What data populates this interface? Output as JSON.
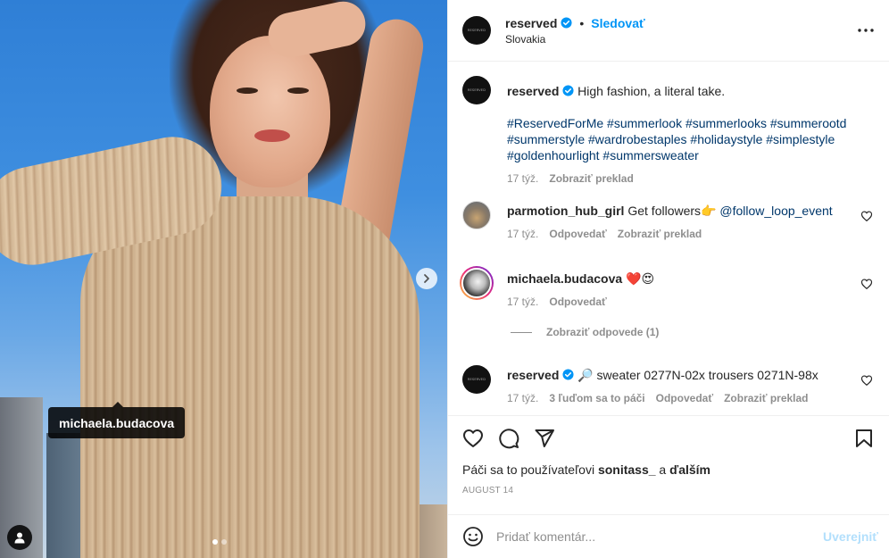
{
  "media": {
    "tag_username": "michaela.budacova",
    "carousel_count": 2,
    "carousel_active": 0
  },
  "header": {
    "avatar_text": "RESERVED",
    "username": "reserved",
    "separator": "•",
    "follow_label": "Sledovať",
    "location": "Slovakia"
  },
  "caption": {
    "username": "reserved",
    "text": "High fashion, a literal take.",
    "hashtags": "#ReservedForMe #summerlook #summerlooks #summerootd #summerstyle #wardrobestaples #holidaystyle #simplestyle #goldenhourlight #summersweater",
    "time": "17 týž.",
    "translate_label": "Zobraziť preklad"
  },
  "comments": [
    {
      "username": "parmotion_hub_girl",
      "text": "Get followers👉",
      "mention": "@follow_loop_event",
      "time": "17 týž.",
      "reply_label": "Odpovedať",
      "translate_label": "Zobraziť preklad"
    },
    {
      "username": "michaela.budacova",
      "text": "❤️😍",
      "time": "17 týž.",
      "reply_label": "Odpovedať",
      "view_replies": "Zobraziť odpovede (1)"
    },
    {
      "username": "reserved",
      "text": "🔎 sweater 0277N-02x trousers 0271N-98x",
      "time": "17 týž.",
      "likes": "3 ľuďom sa to páči",
      "reply_label": "Odpovedať",
      "translate_label": "Zobraziť preklad"
    }
  ],
  "likes": {
    "prefix": "Páči sa to používateľovi ",
    "user": "sonitass_",
    "conj": " a ",
    "others": "ďalším"
  },
  "date": "AUGUST 14",
  "composer": {
    "placeholder": "Pridať komentár...",
    "post_label": "Uverejniť"
  },
  "colors": {
    "accent": "#0095f6",
    "link": "#00376b",
    "muted": "#8e8e8e",
    "post_disabled": "#b2dffc"
  }
}
